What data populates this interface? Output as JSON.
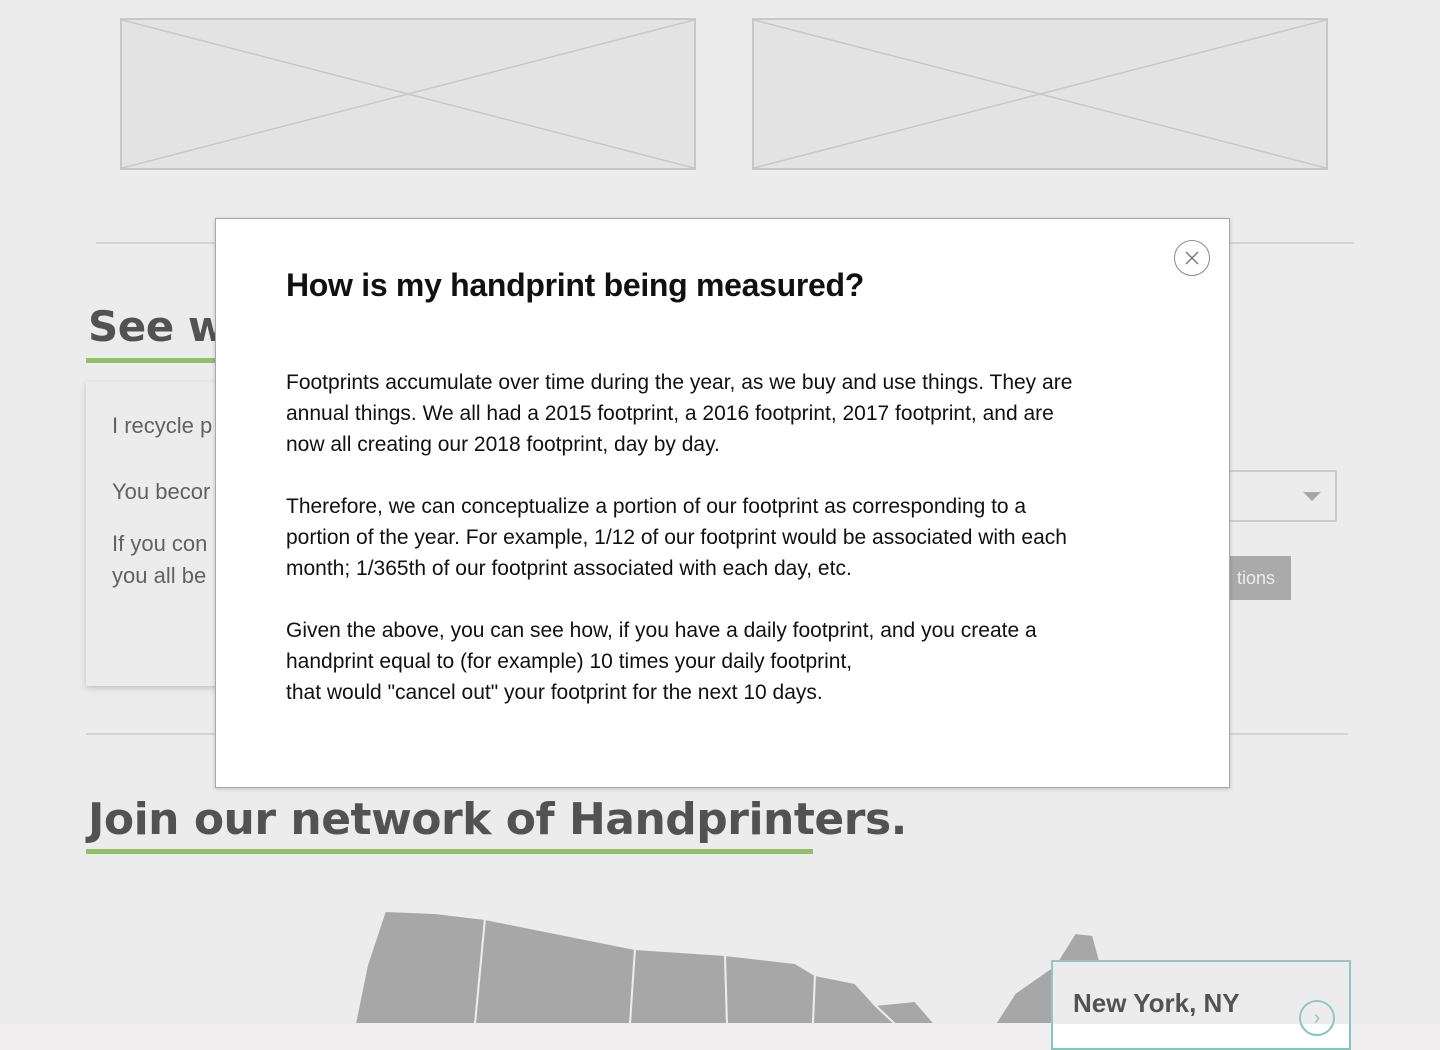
{
  "background": {
    "section_see_heading": "See wh",
    "section_join_heading": "Join our network of Handprinters.",
    "impact_card": {
      "line_1": "I recycle p",
      "line_2": "You becor",
      "line_3": "If you con",
      "line_4": "you all be"
    },
    "actions_button_label": "tions",
    "location": {
      "name": "New York, NY"
    }
  },
  "modal": {
    "title": "How is my handprint being measured?",
    "paragraphs": [
      "Footprints accumulate over time during the year, as we buy and use things.  They are\nannual things. We all had a 2015 footprint, a 2016 footprint, 2017 footprint, and are\nnow all creating our 2018 footprint, day by day.",
      "Therefore, we can conceptualize a portion of our footprint as corresponding to a\nportion of the year. For example, 1/12 of our footprint would be associated with each\nmonth; 1/365th of our footprint associated with each day, etc.",
      "Given the above, you can see how, if you have a daily footprint, and you create a\nhandprint equal to (for example) 10 times your daily footprint,\nthat would \"cancel out\" your footprint for the next 10 days."
    ]
  },
  "colors": {
    "accent_green": "#7cbd3f",
    "accent_teal": "#7fc7bf",
    "scrim": "#efedee"
  },
  "icons": {
    "close": "close-icon",
    "select_caret": "chevron-down-icon",
    "location_arrow": "chevron-right-icon"
  }
}
